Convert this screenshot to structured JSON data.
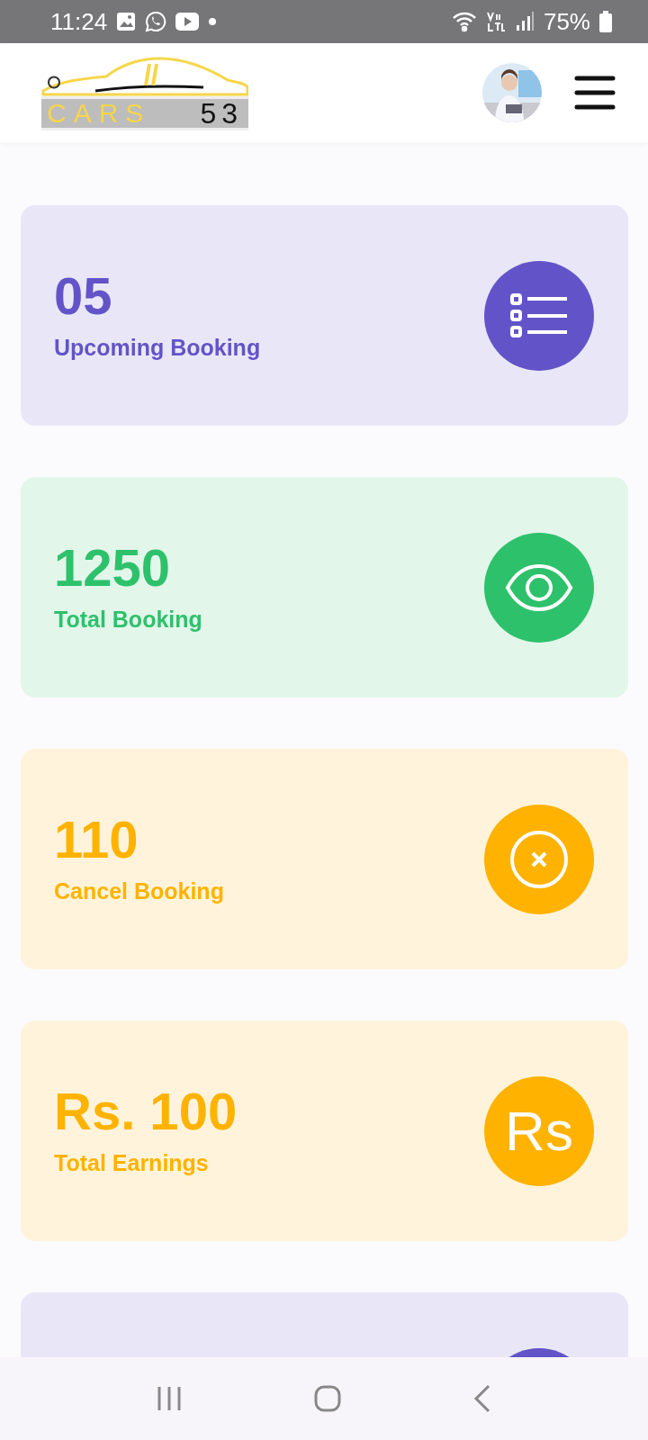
{
  "status_bar": {
    "time": "11:24",
    "battery": "75%"
  },
  "header": {
    "logo": {
      "word": "CARS",
      "number": "53"
    }
  },
  "cards": [
    {
      "value": "05",
      "label": "Upcoming Booking",
      "color": "#6254c8",
      "kind": "list"
    },
    {
      "value": "1250",
      "label": "Total Booking",
      "color": "#2ec16c",
      "kind": "eye"
    },
    {
      "value": "110",
      "label": "Cancel Booking",
      "color": "#ffb300",
      "kind": "cancel"
    },
    {
      "value": "Rs. 100",
      "label": "Total Earnings",
      "color": "#ffb300",
      "kind": "currency",
      "icon_text": "Rs"
    },
    {
      "color": "#6254c8"
    }
  ]
}
